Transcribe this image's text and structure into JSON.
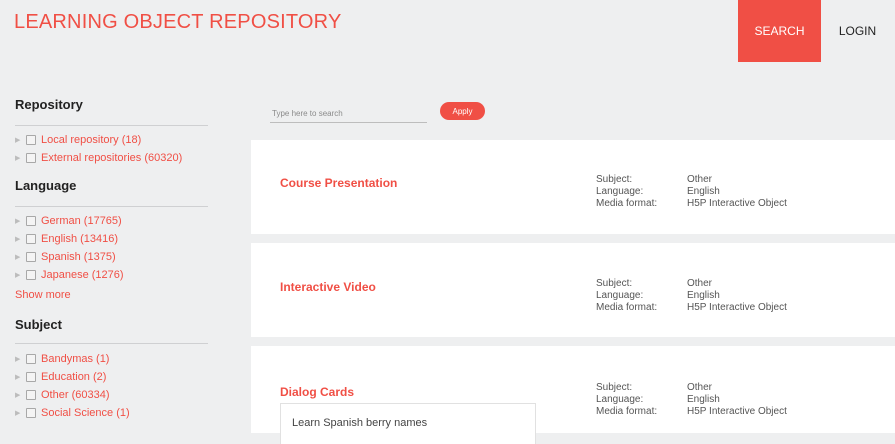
{
  "header": {
    "site_title": "LEARNING OBJECT REPOSITORY",
    "search_label": "SEARCH",
    "login_label": "LOGIN"
  },
  "colors": {
    "accent": "#f04f45",
    "background": "#eeeff0",
    "card": "#ffffff"
  },
  "sidebar": {
    "repository": {
      "heading": "Repository",
      "items": [
        "Local repository (18)",
        "External repositories (60320)"
      ]
    },
    "language": {
      "heading": "Language",
      "items": [
        "German (17765)",
        "English (13416)",
        "Spanish (1375)",
        "Japanese (1276)"
      ],
      "show_more": "Show more"
    },
    "subject": {
      "heading": "Subject",
      "items": [
        "Bandymas (1)",
        "Education (2)",
        "Other (60334)",
        "Social Science (1)"
      ]
    }
  },
  "search": {
    "placeholder": "Type here to search",
    "value": "",
    "apply_label": "Apply"
  },
  "results": [
    {
      "title": "Course Presentation",
      "subject_label": "Subject:",
      "subject": "Other",
      "language_label": "Language:",
      "language": "English",
      "format_label": "Media format:",
      "format": "H5P Interactive Object"
    },
    {
      "title": "Interactive Video",
      "subject_label": "Subject:",
      "subject": "Other",
      "language_label": "Language:",
      "language": "English",
      "format_label": "Media format:",
      "format": "H5P Interactive Object"
    },
    {
      "title": "Dialog Cards",
      "subject_label": "Subject:",
      "subject": "Other",
      "language_label": "Language:",
      "language": "English",
      "format_label": "Media format:",
      "format": "H5P Interactive Object",
      "summary": "Learn Spanish berry names"
    }
  ]
}
